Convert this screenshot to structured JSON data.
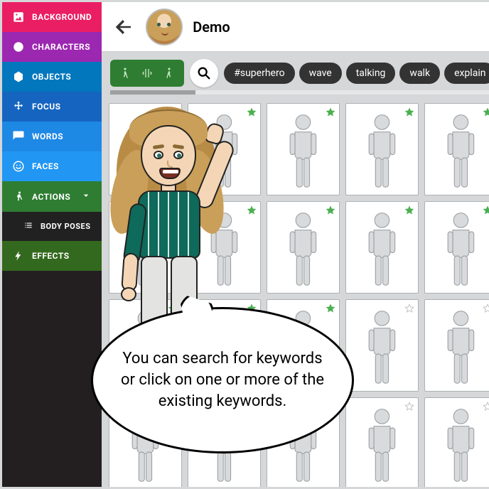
{
  "sidebar": {
    "items": [
      {
        "label": "BACKGROUND",
        "icon": "image-icon"
      },
      {
        "label": "CHARACTERS",
        "icon": "face-icon"
      },
      {
        "label": "OBJECTS",
        "icon": "hexagon-icon"
      },
      {
        "label": "FOCUS",
        "icon": "move-icon"
      },
      {
        "label": "WORDS",
        "icon": "chat-icon"
      },
      {
        "label": "FACES",
        "icon": "smiley-icon"
      },
      {
        "label": "ACTIONS",
        "icon": "run-icon"
      }
    ],
    "sub": [
      {
        "label": "BODY POSES",
        "icon": "list-icon"
      },
      {
        "label": "EFFECTS",
        "icon": "bolt-icon"
      }
    ]
  },
  "header": {
    "title": "Demo"
  },
  "toolbar": {
    "tags": [
      "#superhero",
      "wave",
      "talking",
      "walk",
      "explain"
    ]
  },
  "grid": {
    "poses": [
      {
        "fav": true
      },
      {
        "fav": true
      },
      {
        "fav": true
      },
      {
        "fav": true
      },
      {
        "fav": true
      },
      {
        "fav": true
      },
      {
        "fav": true
      },
      {
        "fav": true
      },
      {
        "fav": true
      },
      {
        "fav": true
      },
      {
        "fav": true
      },
      {
        "fav": true
      },
      {
        "fav": true
      },
      {
        "fav": false
      },
      {
        "fav": false
      },
      {
        "fav": false
      },
      {
        "fav": false
      },
      {
        "fav": false
      },
      {
        "fav": false
      },
      {
        "fav": false
      }
    ]
  },
  "bubble": {
    "text": "You can search for keywords or click on one or more of the existing keywords."
  },
  "colors": {
    "sidebar": [
      "#e91e63",
      "#9c27b0",
      "#0277bd",
      "#1565c0",
      "#1e88e5",
      "#2196f3",
      "#2e7d32",
      "#212121",
      "#33691e"
    ],
    "tag_bg": "#333333",
    "accent_green": "#4caf50"
  }
}
